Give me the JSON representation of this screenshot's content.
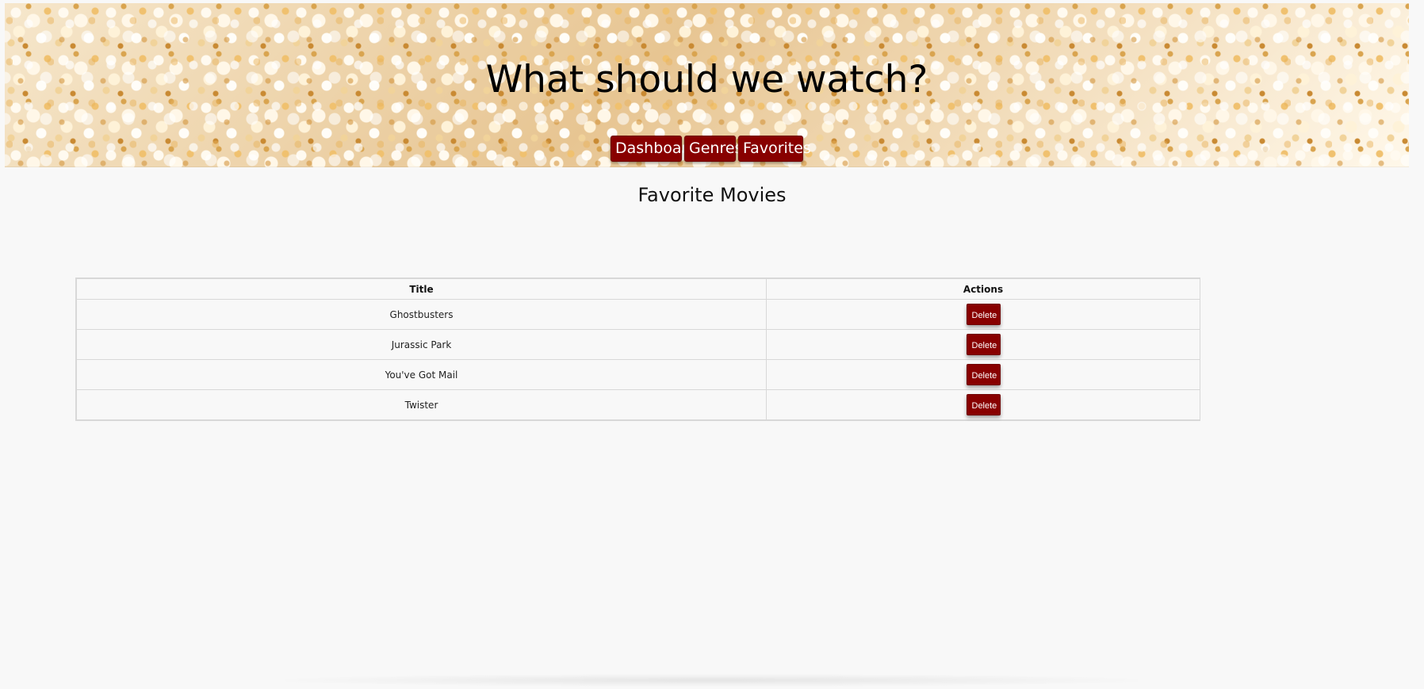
{
  "header": {
    "title": "What should we watch?",
    "nav": [
      {
        "label": "Dashboard"
      },
      {
        "label": "Genres"
      },
      {
        "label": "Favorites"
      }
    ]
  },
  "main": {
    "section_title": "Favorite Movies",
    "table": {
      "columns": [
        "Title",
        "Actions"
      ],
      "rows": [
        {
          "title": "Ghostbusters",
          "action": "Delete"
        },
        {
          "title": "Jurassic Park",
          "action": "Delete"
        },
        {
          "title": "You've Got Mail",
          "action": "Delete"
        },
        {
          "title": "Twister",
          "action": "Delete"
        }
      ]
    }
  },
  "colors": {
    "accent": "#880000",
    "background": "#f8f8f8",
    "border": "#d8d8d8"
  },
  "icons": {
    "hero_background": "popcorn-image"
  }
}
